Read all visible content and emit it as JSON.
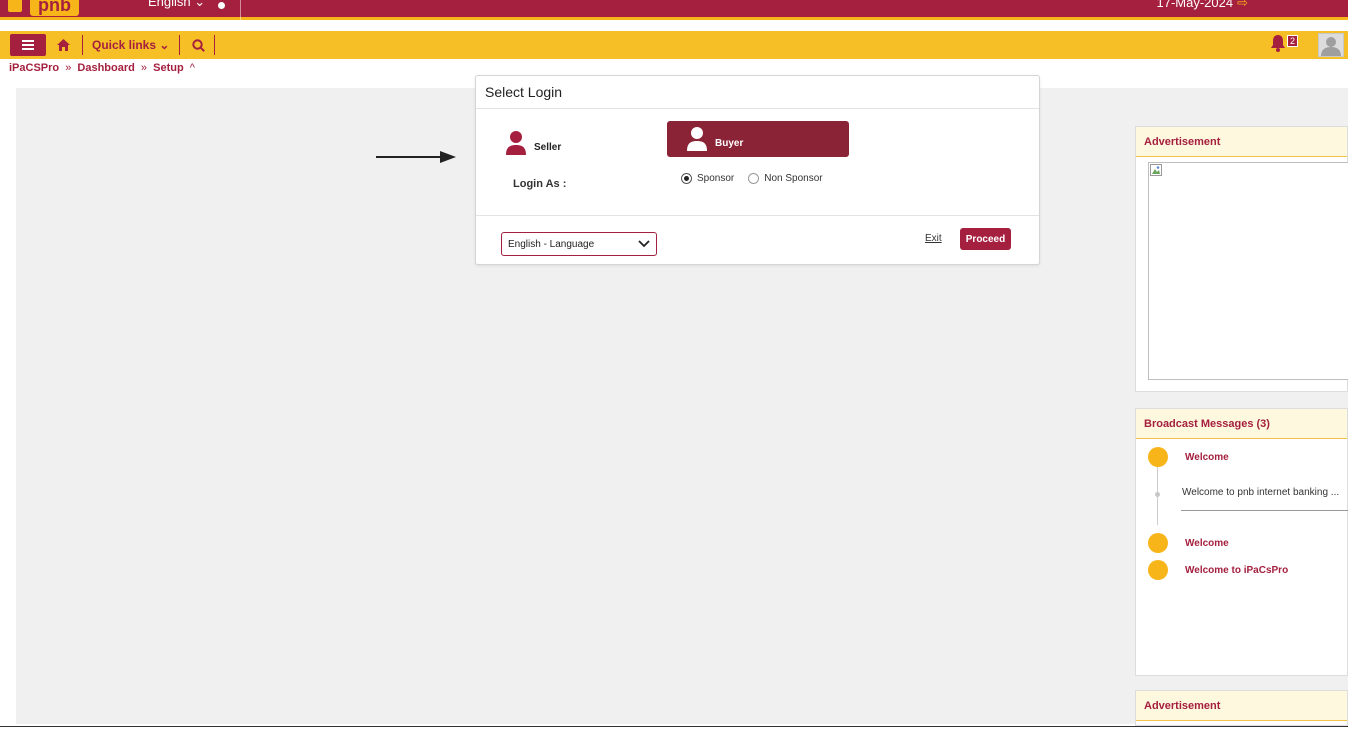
{
  "topbar": {
    "logo_text": "pnb",
    "language": "English ⌄",
    "date": "17-May-2024",
    "date_icon": "logout-arrow-icon"
  },
  "toolbar": {
    "menu_icon": "hamburger-icon",
    "home_icon": "home-icon",
    "quick_links": "Quick links ⌄",
    "search_icon": "search-icon",
    "notification_count": "2",
    "avatar_icon": "user-avatar-icon"
  },
  "breadcrumb": {
    "items": [
      "iPaCSPro",
      "Dashboard",
      "Setup"
    ],
    "separator": "»",
    "caret": "^"
  },
  "dialog": {
    "title": "Select Login",
    "seller_label": "Seller",
    "buyer_label": "Buyer",
    "login_as_label": "Login As :",
    "options": [
      "Sponsor",
      "Non Sponsor"
    ],
    "selected_option": "Sponsor",
    "language_select": "English - Language",
    "exit_label": "Exit",
    "proceed_label": "Proceed"
  },
  "right_panels": {
    "advertisement_title": "Advertisement",
    "broadcast_title": "Broadcast Messages (3)",
    "broadcast_items": [
      {
        "title": "Welcome",
        "message": "Welcome to pnb internet banking ..."
      },
      {
        "title": "Welcome"
      },
      {
        "title": "Welcome to iPaCsPro"
      }
    ],
    "advertisement2_title": "Advertisement"
  },
  "colors": {
    "brand_maroon": "#a5203f",
    "brand_yellow": "#f7b519",
    "buyer_bg": "#8b2336",
    "background_grey": "#f0f0f0"
  }
}
